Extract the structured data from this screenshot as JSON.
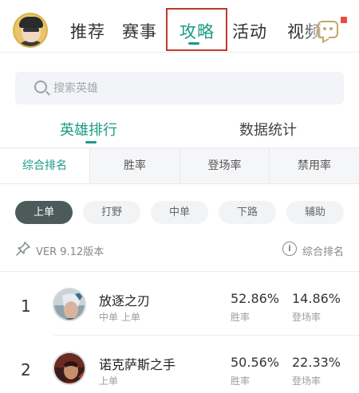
{
  "nav": {
    "tabs": [
      "推荐",
      "赛事",
      "攻略",
      "活动",
      "视频"
    ],
    "active_index": 2
  },
  "search": {
    "placeholder": "搜索英雄"
  },
  "subtabs": [
    "英雄排行",
    "数据统计"
  ],
  "sort_options": [
    "综合排名",
    "胜率",
    "登场率",
    "禁用率"
  ],
  "roles": [
    "上单",
    "打野",
    "中单",
    "下路",
    "辅助"
  ],
  "version": {
    "text": "VER 9.12版本",
    "sort_label": "综合排名"
  },
  "heroes": [
    {
      "rank": "1",
      "name": "放逐之刃",
      "role": "中单 上单",
      "win_rate": "52.86%",
      "win_rate_label": "胜率",
      "pick_rate": "14.86%",
      "pick_rate_label": "登场率"
    },
    {
      "rank": "2",
      "name": "诺克萨斯之手",
      "role": "上单",
      "win_rate": "50.56%",
      "win_rate_label": "胜率",
      "pick_rate": "22.33%",
      "pick_rate_label": "登场率"
    }
  ],
  "colors": {
    "accent": "#1a9a86",
    "highlight_box": "#c0392b",
    "active_role": "#4d5a5a"
  }
}
